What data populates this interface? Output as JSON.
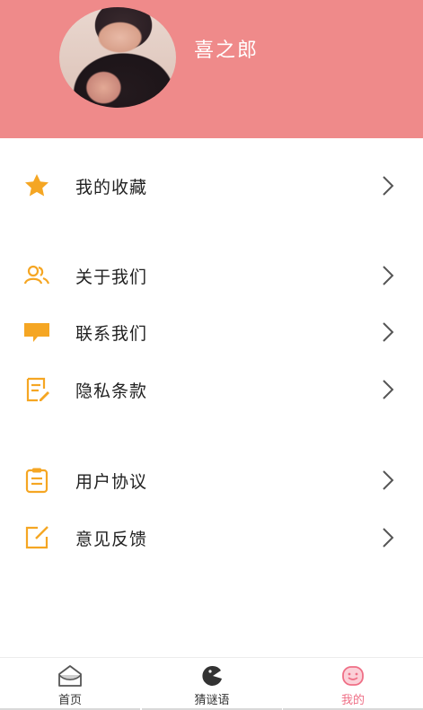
{
  "profile": {
    "username": "喜之郎"
  },
  "menu": {
    "favorites": "我的收藏",
    "about": "关于我们",
    "contact": "联系我们",
    "privacy": "隐私条款",
    "agreement": "用户协议",
    "feedback": "意见反馈"
  },
  "tabs": {
    "home": "首页",
    "riddles": "猜谜语",
    "mine": "我的"
  },
  "colors": {
    "header": "#ef8a8a",
    "accent_icon": "#f5a623",
    "active_tab": "#ef6f86"
  },
  "icons": {
    "favorites": "star-icon",
    "about": "people-icon",
    "contact": "message-icon",
    "privacy": "document-edit-icon",
    "agreement": "clipboard-icon",
    "feedback": "edit-square-icon"
  }
}
